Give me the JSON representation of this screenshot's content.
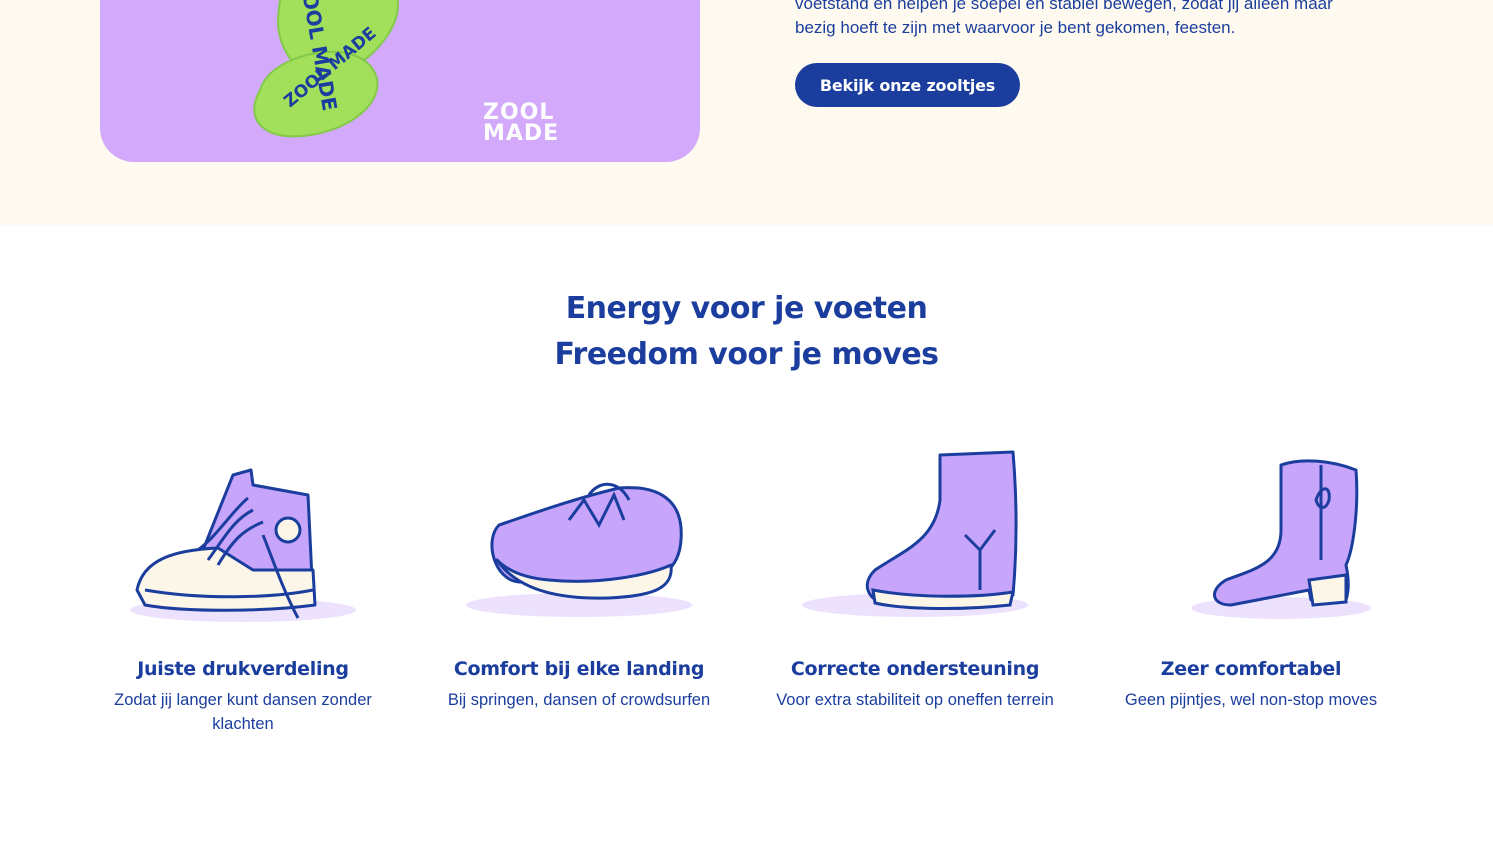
{
  "hero": {
    "brand_logo_line1": "ZOOL",
    "brand_logo_line2": "MADE",
    "insole_print": "ZOOL MADE",
    "text_line1": "voetstand en helpen je soepel en stabiel bewegen, zodat jij alleen maar",
    "text_line2": "bezig hoeft te zijn met waarvoor je bent gekomen, feesten.",
    "cta_label": "Bekijk onze zooltjes"
  },
  "features": {
    "title_line1": "Energy voor je voeten",
    "title_line2": "Freedom voor je moves",
    "items": [
      {
        "icon": "high-top-sneaker-icon",
        "title": "Juiste drukverdeling",
        "text": "Zodat jij langer kunt dansen zonder klachten"
      },
      {
        "icon": "running-shoe-icon",
        "title": "Comfort bij elke landing",
        "text": "Bij springen, dansen of crowdsurfen"
      },
      {
        "icon": "winter-boot-icon",
        "title": "Correcte ondersteuning",
        "text": "Voor extra stabiliteit op oneffen terrein"
      },
      {
        "icon": "cowboy-boot-icon",
        "title": "Zeer comfortabel",
        "text": "Geen pijntjes, wel non-stop moves"
      }
    ]
  },
  "colors": {
    "brand_blue": "#1b3e9e",
    "lilac": "#c6a5fb",
    "insole_green": "#9ae35a",
    "cream": "#fffaef"
  }
}
